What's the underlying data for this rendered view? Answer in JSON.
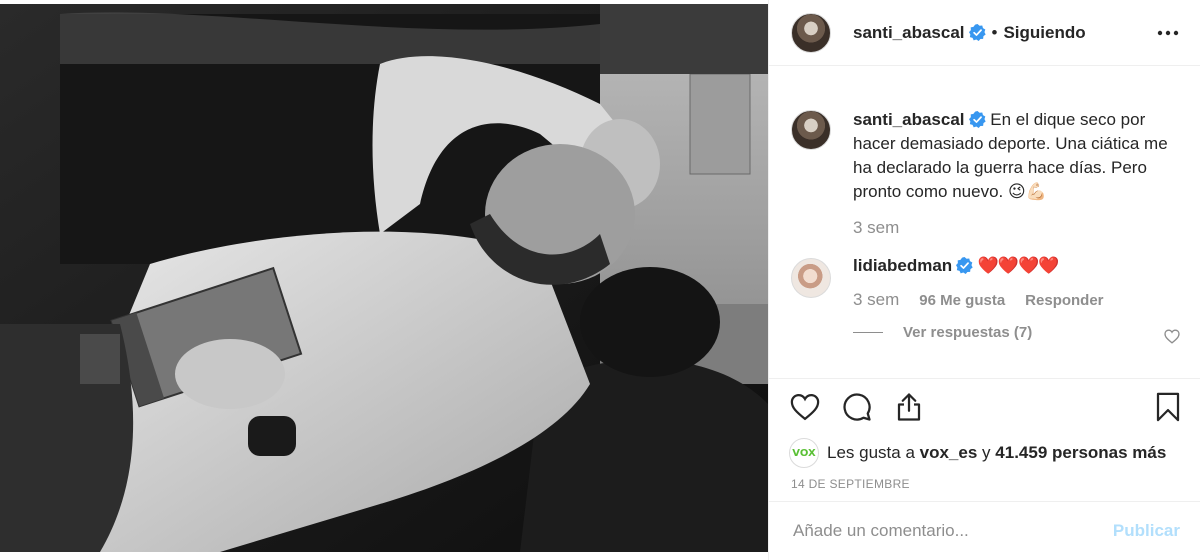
{
  "post": {
    "author": "santi_abascal",
    "follow_status": "Siguiendo",
    "separator": "•",
    "caption": "En el dique seco por hacer demasiado deporte. Una ciática me ha declarado la guerra hace días. Pero pronto como nuevo. 😉💪🏻",
    "caption_time": "3 sem",
    "date": "14 DE SEPTIEMBRE"
  },
  "comment": {
    "author": "lidiabedman",
    "text": "❤️❤️❤️❤️",
    "time": "3 sem",
    "likes": "96 Me gusta",
    "reply_label": "Responder",
    "view_replies": "Ver respuestas (7)"
  },
  "likes": {
    "prefix": "Les gusta a",
    "liker": "vox_es",
    "joiner": "y",
    "others": "41.459 personas más",
    "avatar_text": "VOX"
  },
  "add_comment": {
    "placeholder": "Añade un comentario...",
    "publish_label": "Publicar"
  },
  "icons": {
    "verified": "verified-badge-icon",
    "more": "more-options-icon",
    "like": "heart-icon",
    "comment": "comment-icon",
    "share": "share-icon",
    "save": "bookmark-icon"
  },
  "colors": {
    "verified": "#3897f0",
    "hearts": "#ed4956",
    "publish_disabled": "#b2dffc",
    "vox_green": "#5ac035"
  }
}
